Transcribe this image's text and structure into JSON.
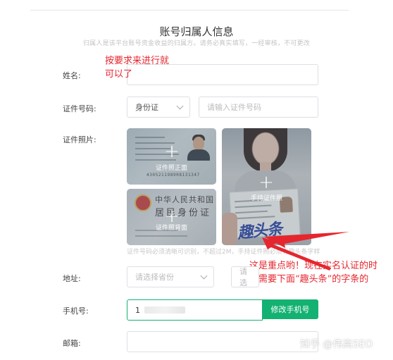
{
  "page": {
    "title": "账号归属人信息",
    "subtitle": "归属人是该平台账号资金收益的归属方。请务必真实填写，一经审核，不可更改"
  },
  "form": {
    "name_label": "姓名:",
    "id_type_label": "证件号码:",
    "id_type_value": "身份证",
    "id_number_placeholder": "请输入证件号码",
    "id_photo_label": "证件照片:",
    "upload_front_caption": "证件照正面",
    "upload_back_caption": "证件照背面",
    "upload_hold_caption": "手持证件照",
    "photo_hint": "证件号码必须清晰可识别，不超过2M，手持证件照必须有趣头条字样",
    "address_label": "地址:",
    "province_placeholder": "请选择省份",
    "city_placeholder": "请选",
    "phone_label": "手机号:",
    "phone_value": "1",
    "change_phone_button": "修改手机号",
    "email_label": "邮箱:"
  },
  "id_card_front": {
    "number": "430521198908131347"
  },
  "id_card_back": {
    "title": "中华人民共和国",
    "subtitle": "居民身份证"
  },
  "held_sign": "趣头条",
  "annotations": {
    "note1_line1": "按要求来进行就",
    "note1_line2": "可以了",
    "note2_line1": "这是重点哟！现在实名认证的时",
    "note2_line2": "候需要下面“趣头条”的字条的"
  },
  "watermark": "知乎 @伟高SEO",
  "colors": {
    "accent_green": "#14b272",
    "annotation_red": "#e5262e",
    "sign_blue": "#233f9e"
  }
}
